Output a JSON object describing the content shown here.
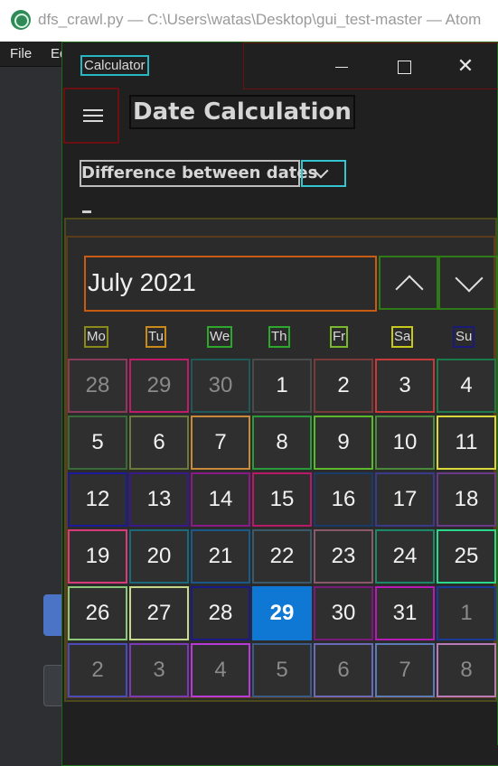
{
  "atom": {
    "title": "dfs_crawl.py — C:\\Users\\watas\\Desktop\\gui_test-master — Atom",
    "menu": [
      "File",
      "Ed"
    ]
  },
  "calculator": {
    "window_title": "Calculator",
    "page_title": "Date Calculation",
    "mode": "Difference between dates",
    "calendar": {
      "month_label": "July 2021",
      "weekdays": [
        "Mo",
        "Tu",
        "We",
        "Th",
        "Fr",
        "Sa",
        "Su"
      ],
      "weeks": [
        [
          "28",
          "29",
          "30",
          "1",
          "2",
          "3",
          "4"
        ],
        [
          "5",
          "6",
          "7",
          "8",
          "9",
          "10",
          "11"
        ],
        [
          "12",
          "13",
          "14",
          "15",
          "16",
          "17",
          "18"
        ],
        [
          "19",
          "20",
          "21",
          "22",
          "23",
          "24",
          "25"
        ],
        [
          "26",
          "27",
          "28",
          "29",
          "30",
          "31",
          "1"
        ],
        [
          "2",
          "3",
          "4",
          "5",
          "6",
          "7",
          "8"
        ]
      ],
      "selected_day": "29",
      "accent_color": "#0f78d4"
    }
  }
}
